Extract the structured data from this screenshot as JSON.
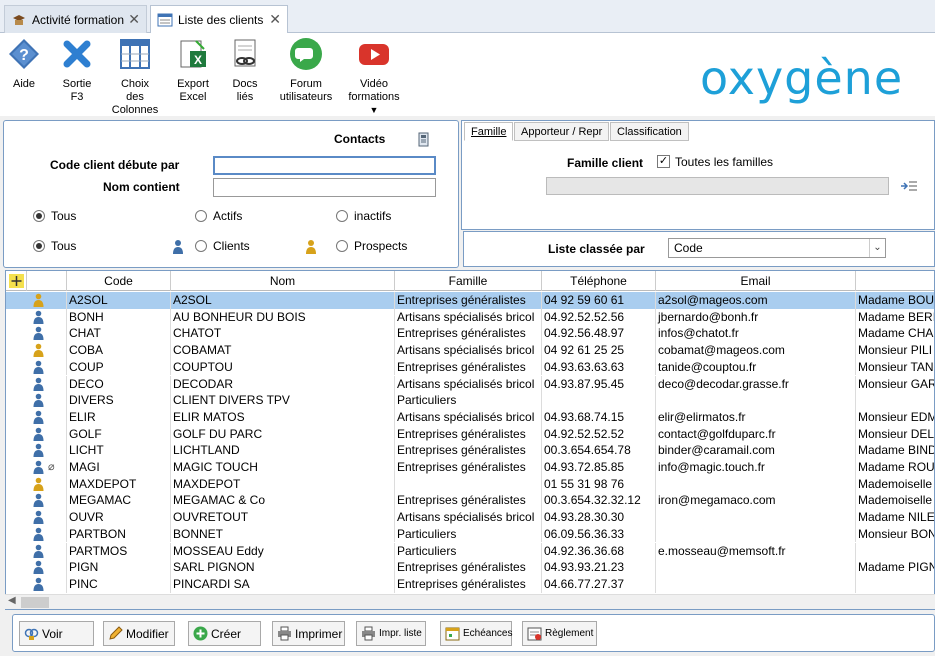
{
  "tabs": [
    {
      "label": "Activité formation",
      "active": false
    },
    {
      "label": "Liste des clients",
      "active": true
    }
  ],
  "toolbar": [
    {
      "id": "aide",
      "label1": "Aide",
      "label2": "",
      "label3": "",
      "icon": "help-icon"
    },
    {
      "id": "sortie",
      "label1": "Sortie",
      "label2": "F3",
      "label3": "",
      "icon": "exit-x-icon"
    },
    {
      "id": "colonnes",
      "label1": "Choix",
      "label2": "des",
      "label3": "Colonnes",
      "icon": "columns-icon"
    },
    {
      "id": "export",
      "label1": "Export",
      "label2": "Excel",
      "label3": "",
      "icon": "excel-icon"
    },
    {
      "id": "docs",
      "label1": "Docs",
      "label2": "liés",
      "label3": "",
      "icon": "linked-docs-icon"
    },
    {
      "id": "forum",
      "label1": "Forum",
      "label2": "utilisateurs",
      "label3": "",
      "icon": "forum-icon"
    },
    {
      "id": "video",
      "label1": "Vidéo",
      "label2": "formations",
      "label3": "",
      "icon": "youtube-icon"
    }
  ],
  "logo": {
    "text": "oxygène",
    "color": "#1ea0d8"
  },
  "filters": {
    "contacts_label": "Contacts",
    "code_label": "Code client débute par",
    "code_value": "",
    "nom_label": "Nom contient",
    "nom_value": "",
    "status_options": [
      "Tous",
      "Actifs",
      "inactifs"
    ],
    "status_selected": "Tous",
    "type_options": [
      "Tous",
      "Clients",
      "Prospects"
    ],
    "type_selected": "Tous"
  },
  "family_panel": {
    "tabs": [
      "Famille",
      "Apporteur / Repr",
      "Classification"
    ],
    "active_tab": "Famille",
    "famille_label": "Famille client",
    "toutes_label": "Toutes les familles",
    "toutes_checked": true
  },
  "sort": {
    "label": "Liste classée par",
    "value": "Code"
  },
  "grid": {
    "headers": [
      "Code",
      "Nom",
      "Famille",
      "Téléphone",
      "Email"
    ],
    "rows": [
      {
        "code": "A2SOL",
        "nom": "A2SOL",
        "famille": "Entreprises généralistes",
        "tel": "04 92 59 60 61",
        "email": "a2sol@mageos.com",
        "contact": "Madame BOU",
        "selected": true,
        "icon": "yellow",
        "clip": false
      },
      {
        "code": "BONH",
        "nom": "AU BONHEUR DU BOIS",
        "famille": "Artisans spécialisés bricol",
        "tel": "04.92.52.52.56",
        "email": "jbernardo@bonh.fr",
        "contact": "Madame BERI",
        "selected": false,
        "icon": "blue",
        "clip": false
      },
      {
        "code": "CHAT",
        "nom": "CHATOT",
        "famille": "Entreprises généralistes",
        "tel": "04.92.56.48.97",
        "email": "infos@chatot.fr",
        "contact": "Madame CHAU",
        "selected": false,
        "icon": "blue",
        "clip": false
      },
      {
        "code": "COBA",
        "nom": "COBAMAT",
        "famille": "Artisans spécialisés bricol",
        "tel": "04 92 61 25 25",
        "email": "cobamat@mageos.com",
        "contact": "Monsieur PILI",
        "selected": false,
        "icon": "yellow",
        "clip": false
      },
      {
        "code": "COUP",
        "nom": "COUPTOU",
        "famille": "Entreprises généralistes",
        "tel": "04.93.63.63.63",
        "email": "tanide@couptou.fr",
        "contact": "Monsieur TANI",
        "selected": false,
        "icon": "blue",
        "clip": false
      },
      {
        "code": "DECO",
        "nom": "DECODAR",
        "famille": "Artisans spécialisés bricol",
        "tel": "04.93.87.95.45",
        "email": "deco@decodar.grasse.fr",
        "contact": "Monsieur GAR",
        "selected": false,
        "icon": "blue",
        "clip": false
      },
      {
        "code": "DIVERS",
        "nom": "CLIENT DIVERS TPV",
        "famille": "Particuliers",
        "tel": "",
        "email": "",
        "contact": "",
        "selected": false,
        "icon": "blue",
        "clip": false
      },
      {
        "code": "ELIR",
        "nom": "ELIR MATOS",
        "famille": "Artisans spécialisés bricol",
        "tel": "04.93.68.74.15",
        "email": "elir@elirmatos.fr",
        "contact": "Monsieur EDM",
        "selected": false,
        "icon": "blue",
        "clip": false
      },
      {
        "code": "GOLF",
        "nom": "GOLF DU PARC",
        "famille": "Entreprises généralistes",
        "tel": "04.92.52.52.52",
        "email": "contact@golfduparc.fr",
        "contact": "Monsieur DEL",
        "selected": false,
        "icon": "blue",
        "clip": false
      },
      {
        "code": "LICHT",
        "nom": "LICHTLAND",
        "famille": "Entreprises généralistes",
        "tel": "00.3.654.654.78",
        "email": "binder@caramail.com",
        "contact": "Madame BIND",
        "selected": false,
        "icon": "blue",
        "clip": false
      },
      {
        "code": "MAGI",
        "nom": "MAGIC TOUCH",
        "famille": "Entreprises généralistes",
        "tel": "04.93.72.85.85",
        "email": "info@magic.touch.fr",
        "contact": "Madame ROU",
        "selected": false,
        "icon": "blue",
        "clip": true
      },
      {
        "code": "MAXDEPOT",
        "nom": "MAXDEPOT",
        "famille": "",
        "tel": "01 55 31 98 76",
        "email": "",
        "contact": "Mademoiselle",
        "selected": false,
        "icon": "yellow",
        "clip": false
      },
      {
        "code": "MEGAMAC",
        "nom": "MEGAMAC & Co",
        "famille": "Entreprises généralistes",
        "tel": "00.3.654.32.32.12",
        "email": "iron@megamaco.com",
        "contact": "Mademoiselle",
        "selected": false,
        "icon": "blue",
        "clip": false
      },
      {
        "code": "OUVR",
        "nom": "OUVRETOUT",
        "famille": "Artisans spécialisés bricol",
        "tel": "04.93.28.30.30",
        "email": "",
        "contact": "Madame NILE",
        "selected": false,
        "icon": "blue",
        "clip": false
      },
      {
        "code": "PARTBON",
        "nom": "BONNET",
        "famille": "Particuliers",
        "tel": "06.09.56.36.33",
        "email": "",
        "contact": "Monsieur BON",
        "selected": false,
        "icon": "blue",
        "clip": false
      },
      {
        "code": "PARTMOS",
        "nom": "MOSSEAU Eddy",
        "famille": "Particuliers",
        "tel": "04.92.36.36.68",
        "email": "e.mosseau@memsoft.fr",
        "contact": "",
        "selected": false,
        "icon": "blue",
        "clip": false
      },
      {
        "code": "PIGN",
        "nom": "SARL PIGNON",
        "famille": "Entreprises généralistes",
        "tel": "04.93.93.21.23",
        "email": "",
        "contact": "Madame PIGN",
        "selected": false,
        "icon": "blue",
        "clip": false
      },
      {
        "code": "PINC",
        "nom": "PINCARDI SA",
        "famille": "Entreprises généralistes",
        "tel": "04.66.77.27.37",
        "email": "",
        "contact": "",
        "selected": false,
        "icon": "blue",
        "clip": false
      }
    ]
  },
  "actions": [
    {
      "id": "voir",
      "label": "Voir",
      "icon": "view-icon"
    },
    {
      "id": "modifier",
      "label": "Modifier",
      "icon": "pencil-icon"
    },
    {
      "id": "creer",
      "label": "Créer",
      "icon": "plus-icon"
    },
    {
      "id": "imprimer",
      "label": "Imprimer",
      "icon": "printer-icon"
    },
    {
      "id": "impr_liste",
      "label": "Impr. liste",
      "icon": "printer-list-icon"
    },
    {
      "id": "echeances",
      "label": "Echéances",
      "icon": "calendar-icon"
    },
    {
      "id": "reglement",
      "label": "Règlement",
      "icon": "payment-icon"
    }
  ],
  "colors": {
    "accent": "#1ea0d8",
    "selection": "#a9cdef",
    "panel_border": "#7a9cc4"
  }
}
